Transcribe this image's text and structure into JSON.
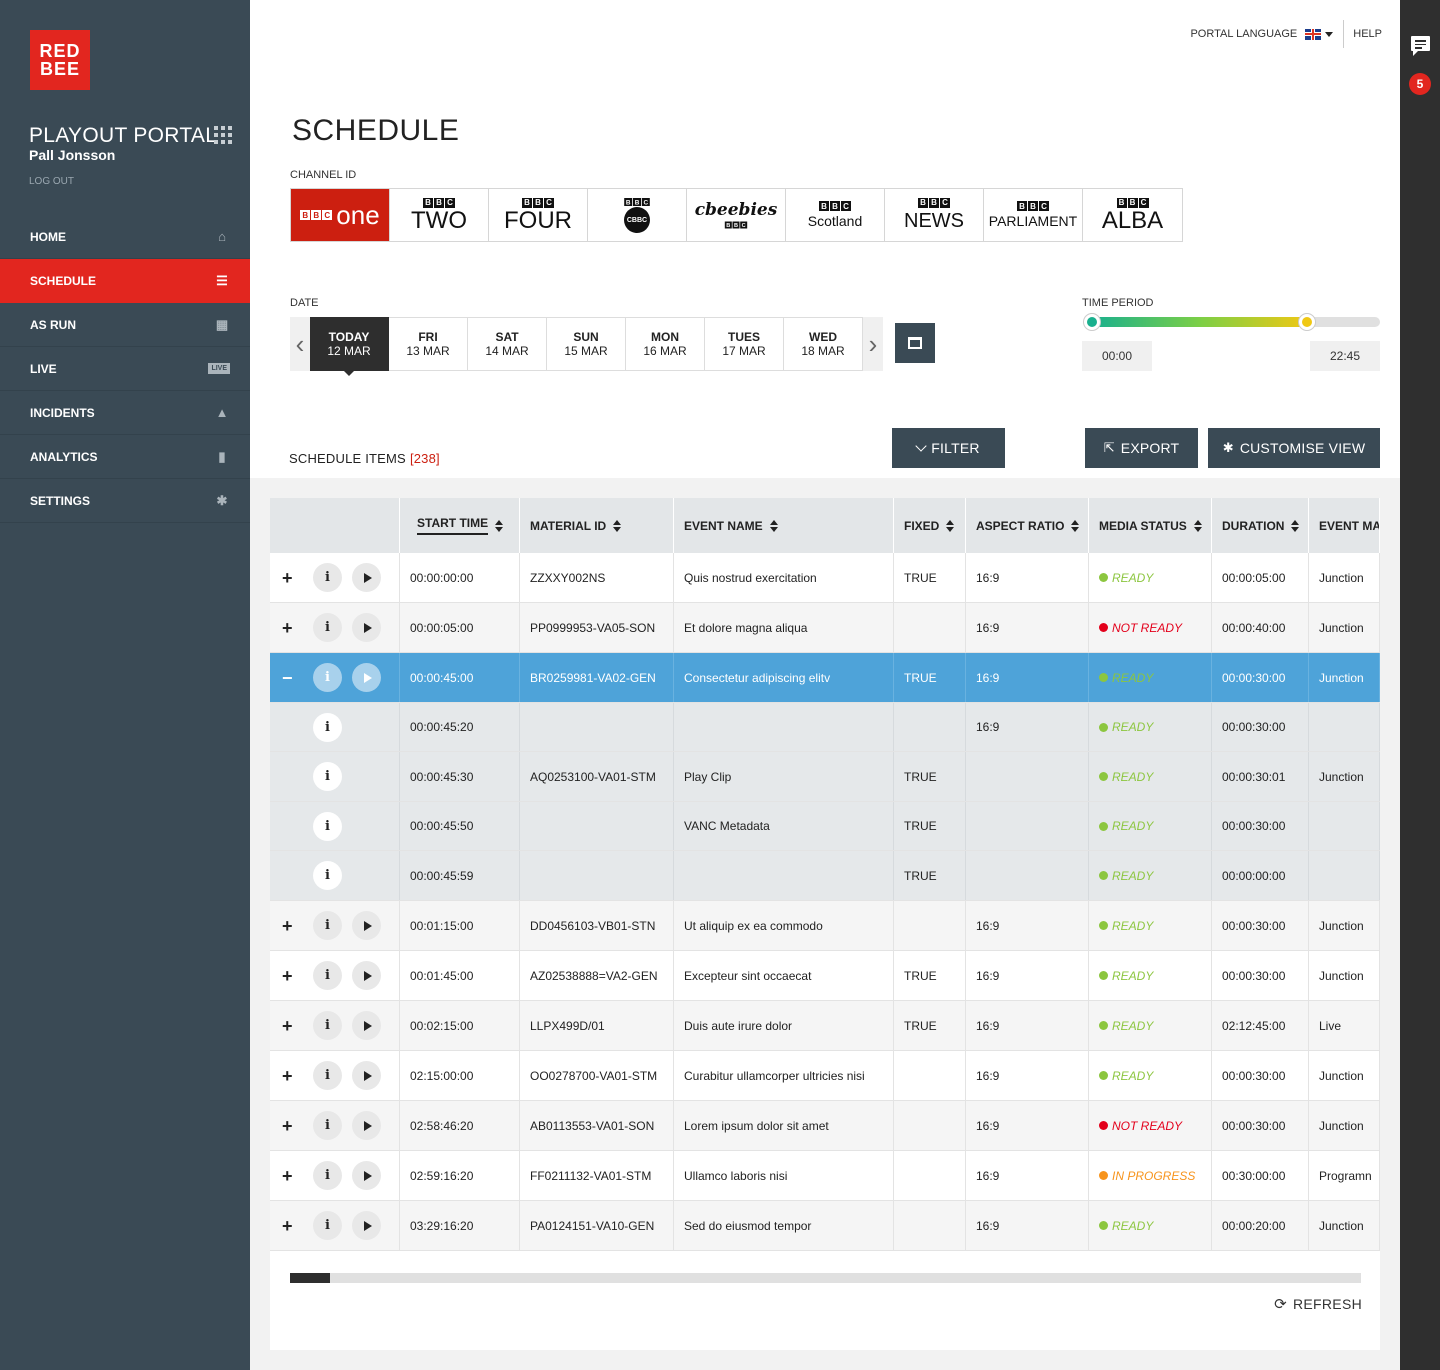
{
  "brand": {
    "logo_line1": "RED",
    "logo_line2": "BEE",
    "color": "#e2261f"
  },
  "sidebar": {
    "title": "PLAYOUT PORTAL",
    "user": "Pall Jonsson",
    "logout": "LOG OUT",
    "items": [
      {
        "label": "HOME",
        "icon": "home-icon",
        "glyph": "⌂"
      },
      {
        "label": "SCHEDULE",
        "icon": "schedule-icon",
        "glyph": "☰"
      },
      {
        "label": "AS RUN",
        "icon": "calendar-icon",
        "glyph": "▦"
      },
      {
        "label": "LIVE",
        "icon": "live-icon",
        "glyph": "LIVE"
      },
      {
        "label": "INCIDENTS",
        "icon": "warning-icon",
        "glyph": "▲"
      },
      {
        "label": "ANALYTICS",
        "icon": "bar-chart-icon",
        "glyph": "▮"
      },
      {
        "label": "SETTINGS",
        "icon": "gear-icon",
        "glyph": "✱"
      }
    ],
    "active_index": 1
  },
  "header": {
    "language_label": "PORTAL LANGUAGE",
    "help": "HELP"
  },
  "notifications": {
    "count": "5"
  },
  "page": {
    "title": "SCHEDULE",
    "channel_label": "CHANNEL ID",
    "date_label": "DATE",
    "time_period_label": "TIME PERIOD"
  },
  "channels": [
    {
      "name": "one",
      "brand": "BBC One"
    },
    {
      "name": "TWO",
      "brand": "BBC Two"
    },
    {
      "name": "FOUR",
      "brand": "BBC Four"
    },
    {
      "name": "CBBC",
      "brand": "CBBC"
    },
    {
      "name": "cbeebies",
      "brand": "CBeebies"
    },
    {
      "name": "Scotland",
      "brand": "BBC Scotland"
    },
    {
      "name": "NEWS",
      "brand": "BBC News"
    },
    {
      "name": "PARLIAMENT",
      "brand": "BBC Parliament"
    },
    {
      "name": "ALBA",
      "brand": "BBC Alba"
    }
  ],
  "dates": [
    {
      "day": "TODAY",
      "date": "12 MAR"
    },
    {
      "day": "FRI",
      "date": "13 MAR"
    },
    {
      "day": "SAT",
      "date": "14 MAR"
    },
    {
      "day": "SUN",
      "date": "15 MAR"
    },
    {
      "day": "MON",
      "date": "16 MAR"
    },
    {
      "day": "TUES",
      "date": "17 MAR"
    },
    {
      "day": "WED",
      "date": "18 MAR"
    }
  ],
  "time_period": {
    "start": "00:00",
    "end": "22:45"
  },
  "schedule": {
    "label": "SCHEDULE ITEMS",
    "count": "[238]",
    "filter": "FILTER",
    "export": "EXPORT",
    "customise": "CUSTOMISE VIEW",
    "refresh": "REFRESH"
  },
  "table": {
    "columns": [
      "START TIME",
      "MATERIAL ID",
      "EVENT NAME",
      "FIXED",
      "ASPECT RATIO",
      "MEDIA STATUS",
      "DURATION",
      "EVENT MA"
    ],
    "rows": [
      {
        "type": "main",
        "expander": "+",
        "start": "00:00:00:00",
        "material": "ZZXXY002NS",
        "event": "Quis nostrud exercitation",
        "fixed": "TRUE",
        "aspect": "16:9",
        "status": "READY",
        "duration": "00:00:05:00",
        "event_ma": "Junction"
      },
      {
        "type": "main",
        "expander": "+",
        "start": "00:00:05:00",
        "material": "PP0999953-VA05-SON",
        "event": "Et dolore magna aliqua",
        "fixed": "",
        "aspect": "16:9",
        "status": "NOT READY",
        "duration": "00:00:40:00",
        "event_ma": "Junction"
      },
      {
        "type": "selected",
        "expander": "−",
        "start": "00:00:45:00",
        "material": "BR0259981-VA02-GEN",
        "event": "Consectetur adipiscing elitv",
        "fixed": "TRUE",
        "aspect": "16:9",
        "status": "READY",
        "duration": "00:00:30:00",
        "event_ma": "Junction"
      },
      {
        "type": "sub",
        "start": "00:00:45:20",
        "material": "",
        "event": "",
        "fixed": "",
        "aspect": "16:9",
        "status": "READY",
        "duration": "00:00:30:00",
        "event_ma": ""
      },
      {
        "type": "sub",
        "start": "00:00:45:30",
        "material": "AQ0253100-VA01-STM",
        "event": "Play Clip",
        "fixed": "TRUE",
        "aspect": "",
        "status": "READY",
        "duration": "00:00:30:01",
        "event_ma": "Junction"
      },
      {
        "type": "sub",
        "start": "00:00:45:50",
        "material": "",
        "event": "VANC Metadata",
        "fixed": "TRUE",
        "aspect": "",
        "status": "READY",
        "duration": "00:00:30:00",
        "event_ma": ""
      },
      {
        "type": "sub",
        "start": "00:00:45:59",
        "material": "",
        "event": "",
        "fixed": "TRUE",
        "aspect": "",
        "status": "READY",
        "duration": "00:00:00:00",
        "event_ma": ""
      },
      {
        "type": "main",
        "expander": "+",
        "start": "00:01:15:00",
        "material": "DD0456103-VB01-STN",
        "event": "Ut aliquip ex ea commodo",
        "fixed": "",
        "aspect": "16:9",
        "status": "READY",
        "duration": "00:00:30:00",
        "event_ma": "Junction"
      },
      {
        "type": "main",
        "expander": "+",
        "start": "00:01:45:00",
        "material": "AZ02538888=VA2-GEN",
        "event": "Excepteur sint occaecat",
        "fixed": "TRUE",
        "aspect": "16:9",
        "status": "READY",
        "duration": "00:00:30:00",
        "event_ma": "Junction"
      },
      {
        "type": "main",
        "expander": "+",
        "start": "00:02:15:00",
        "material": "LLPX499D/01",
        "event": "Duis aute irure dolor",
        "fixed": "TRUE",
        "aspect": "16:9",
        "status": "READY",
        "duration": "02:12:45:00",
        "event_ma": "Live"
      },
      {
        "type": "main",
        "expander": "+",
        "start": "02:15:00:00",
        "material": "OO0278700-VA01-STM",
        "event": "Curabitur ullamcorper ultricies nisi",
        "fixed": "",
        "aspect": "16:9",
        "status": "READY",
        "duration": "00:00:30:00",
        "event_ma": "Junction"
      },
      {
        "type": "main",
        "expander": "+",
        "start": "02:58:46:20",
        "material": "AB0113553-VA01-SON",
        "event": "Lorem ipsum dolor sit amet",
        "fixed": "",
        "aspect": "16:9",
        "status": "NOT READY",
        "duration": "00:00:30:00",
        "event_ma": "Junction"
      },
      {
        "type": "main",
        "expander": "+",
        "start": "02:59:16:20",
        "material": "FF0211132-VA01-STM",
        "event": "Ullamco laboris nisi",
        "fixed": "",
        "aspect": "16:9",
        "status": "IN PROGRESS",
        "duration": "00:30:00:00",
        "event_ma": "Programn"
      },
      {
        "type": "main",
        "expander": "+",
        "start": "03:29:16:20",
        "material": "PA0124151-VA10-GEN",
        "event": "Sed do eiusmod tempor",
        "fixed": "",
        "aspect": "16:9",
        "status": "READY",
        "duration": "00:00:20:00",
        "event_ma": "Junction"
      }
    ]
  },
  "status_colors": {
    "READY": "#8cc63f",
    "NOT READY": "#e3001b",
    "IN PROGRESS": "#f7941d"
  }
}
